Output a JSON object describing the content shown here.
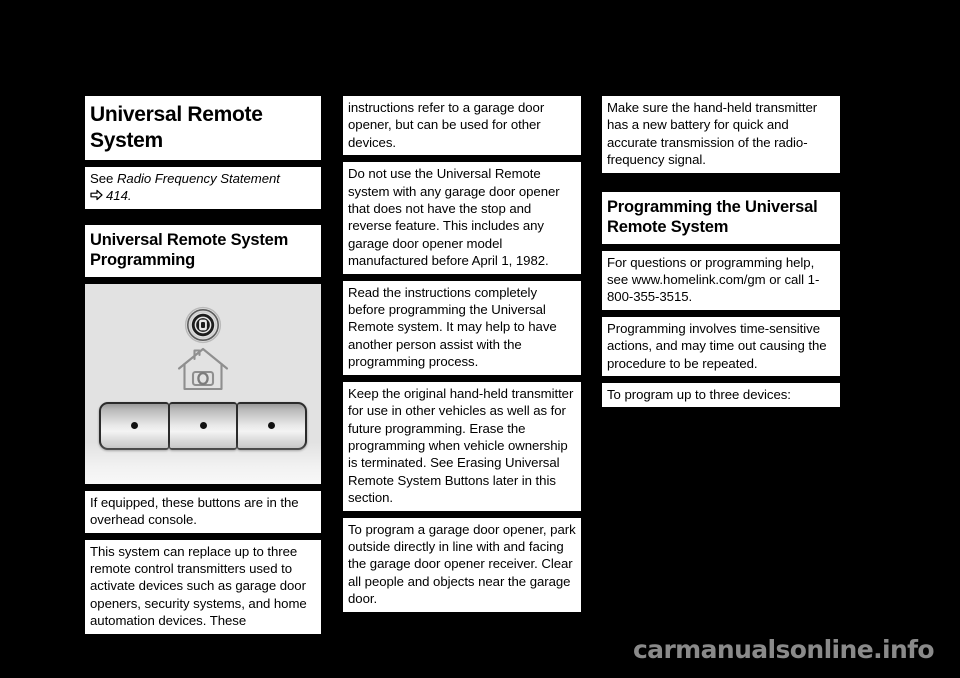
{
  "page": {
    "background_color": "#000000",
    "text_block_color": "#ffffff",
    "watermark": "carmanualsonline.info",
    "watermark_color": "#8a8a8a"
  },
  "left_column": {
    "title": "Universal Remote System",
    "cross_reference": {
      "see_label": "See ",
      "topic": "Radio Frequency Statement",
      "arrow_icon": "page-reference-arrow-icon",
      "page": "414."
    },
    "section_heading": "Universal Remote System Programming",
    "figure": {
      "name": "universal-remote-buttons-illustration",
      "background_color": "#e2e2e2",
      "led_icon": "homelink-led-indicator-icon",
      "house_icon": "homelink-house-icon",
      "buttons": [
        {
          "label": "button-1",
          "indicator": "dot"
        },
        {
          "label": "button-2",
          "indicator": "dot"
        },
        {
          "label": "button-3",
          "indicator": "dot"
        }
      ]
    },
    "paragraphs": [
      "If equipped, these buttons are in the overhead console.",
      "This system can replace up to three remote control transmitters used to activate devices such as garage door openers, security systems, and home automation devices. These"
    ]
  },
  "middle_column": {
    "paragraphs": [
      "instructions refer to a garage door opener, but can be used for other devices.",
      "Do not use the Universal Remote system with any garage door opener that does not have the stop and reverse feature. This includes any garage door opener model manufactured before April 1, 1982.",
      "Read the instructions completely before programming the Universal Remote system. It may help to have another person assist with the programming process.",
      "Keep the original hand-held transmitter for use in other vehicles as well as for future programming. Erase the programming when vehicle ownership is terminated. See  Erasing Universal Remote System Buttons  later in this section.",
      "To program a garage door opener, park outside directly in line with and facing the garage door opener receiver. Clear all people and objects near the garage door."
    ]
  },
  "right_column": {
    "paragraph_top": "Make sure the hand-held transmitter has a new battery for quick and accurate transmission of the radio-frequency signal.",
    "section_heading": "Programming the Universal Remote System",
    "paragraphs": [
      "For questions or programming help, see www.homelink.com/gm or call 1-800-355-3515.",
      "Programming involves time-sensitive actions, and may time out causing the procedure to be repeated.",
      "To program up to three devices:"
    ]
  }
}
